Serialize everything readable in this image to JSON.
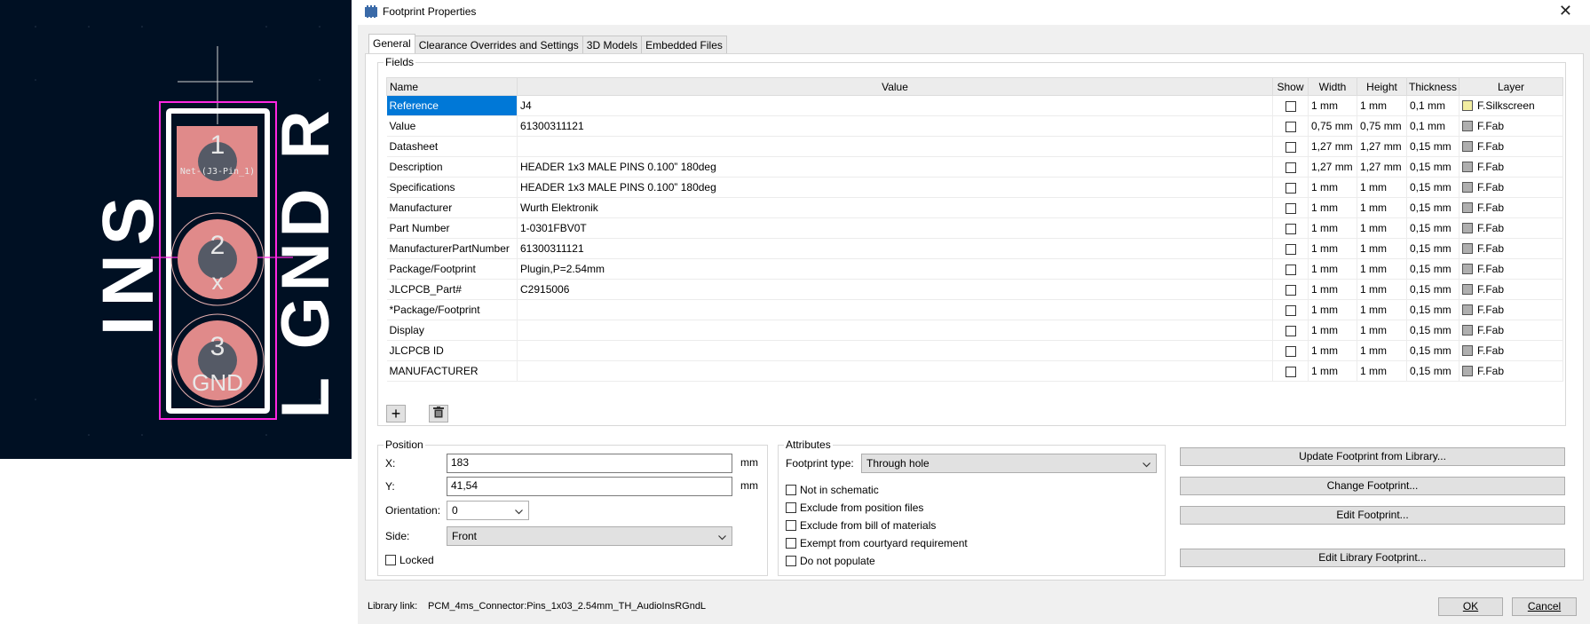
{
  "pcb": {
    "pads": [
      {
        "number": "1",
        "net": "Net-(J3-Pin_1)"
      },
      {
        "number": "2",
        "net": "x"
      },
      {
        "number": "3",
        "net": "GND"
      }
    ],
    "silk_left": "INS",
    "silk_right": "L GND R",
    "colors": {
      "background": "#001023",
      "pad": "#e08a8a",
      "courtyard": "#ff26e2",
      "silkscreen": "#ffffff",
      "drill": "#555a66"
    }
  },
  "dialog": {
    "title": "Footprint Properties",
    "close_glyph": "✕",
    "tabs": [
      "General",
      "Clearance Overrides and Settings",
      "3D Models",
      "Embedded Files"
    ],
    "fields_group": "Fields",
    "columns": [
      "Name",
      "Value",
      "Show",
      "Width",
      "Height",
      "Thickness",
      "Layer"
    ],
    "rows": [
      {
        "name": "Reference",
        "value": "J4",
        "width": "1 mm",
        "height": "1 mm",
        "thickness": "0,1 mm",
        "layer": "F.Silkscreen",
        "layer_color": "#f2eda1"
      },
      {
        "name": "Value",
        "value": "61300311121",
        "width": "0,75 mm",
        "height": "0,75 mm",
        "thickness": "0,1 mm",
        "layer": "F.Fab",
        "layer_color": "#afafaf"
      },
      {
        "name": "Datasheet",
        "value": "",
        "width": "1,27 mm",
        "height": "1,27 mm",
        "thickness": "0,15 mm",
        "layer": "F.Fab",
        "layer_color": "#afafaf"
      },
      {
        "name": "Description",
        "value": "HEADER 1x3 MALE PINS 0.100” 180deg",
        "width": "1,27 mm",
        "height": "1,27 mm",
        "thickness": "0,15 mm",
        "layer": "F.Fab",
        "layer_color": "#afafaf"
      },
      {
        "name": "Specifications",
        "value": "HEADER 1x3 MALE PINS 0.100” 180deg",
        "width": "1 mm",
        "height": "1 mm",
        "thickness": "0,15 mm",
        "layer": "F.Fab",
        "layer_color": "#afafaf"
      },
      {
        "name": "Manufacturer",
        "value": "Wurth Elektronik",
        "width": "1 mm",
        "height": "1 mm",
        "thickness": "0,15 mm",
        "layer": "F.Fab",
        "layer_color": "#afafaf"
      },
      {
        "name": "Part Number",
        "value": "1-0301FBV0T",
        "width": "1 mm",
        "height": "1 mm",
        "thickness": "0,15 mm",
        "layer": "F.Fab",
        "layer_color": "#afafaf"
      },
      {
        "name": "ManufacturerPartNumber",
        "value": "61300311121",
        "width": "1 mm",
        "height": "1 mm",
        "thickness": "0,15 mm",
        "layer": "F.Fab",
        "layer_color": "#afafaf"
      },
      {
        "name": "Package/Footprint",
        "value": "Plugin,P=2.54mm",
        "width": "1 mm",
        "height": "1 mm",
        "thickness": "0,15 mm",
        "layer": "F.Fab",
        "layer_color": "#afafaf"
      },
      {
        "name": "JLCPCB_Part#",
        "value": "C2915006",
        "width": "1 mm",
        "height": "1 mm",
        "thickness": "0,15 mm",
        "layer": "F.Fab",
        "layer_color": "#afafaf"
      },
      {
        "name": "*Package/Footprint",
        "value": "",
        "width": "1 mm",
        "height": "1 mm",
        "thickness": "0,15 mm",
        "layer": "F.Fab",
        "layer_color": "#afafaf"
      },
      {
        "name": "Display",
        "value": "",
        "width": "1 mm",
        "height": "1 mm",
        "thickness": "0,15 mm",
        "layer": "F.Fab",
        "layer_color": "#afafaf"
      },
      {
        "name": "JLCPCB ID",
        "value": "",
        "width": "1 mm",
        "height": "1 mm",
        "thickness": "0,15 mm",
        "layer": "F.Fab",
        "layer_color": "#afafaf"
      },
      {
        "name": "MANUFACTURER",
        "value": "",
        "width": "1 mm",
        "height": "1 mm",
        "thickness": "0,15 mm",
        "layer": "F.Fab",
        "layer_color": "#afafaf"
      }
    ],
    "add_field_glyph": "+",
    "position": {
      "title": "Position",
      "x_label": "X:",
      "x_value": "183",
      "x_unit": "mm",
      "y_label": "Y:",
      "y_value": "41,54",
      "y_unit": "mm",
      "orientation_label": "Orientation:",
      "orientation_value": "0",
      "side_label": "Side:",
      "side_value": "Front",
      "locked_label": "Locked"
    },
    "attributes": {
      "title": "Attributes",
      "footprint_type_label": "Footprint type:",
      "footprint_type_value": "Through hole",
      "checks": [
        "Not in schematic",
        "Exclude from position files",
        "Exclude from bill of materials",
        "Exempt from courtyard requirement",
        "Do not populate"
      ]
    },
    "actions": {
      "update": "Update Footprint from Library...",
      "change": "Change Footprint...",
      "edit": "Edit Footprint...",
      "edit_library": "Edit Library Footprint..."
    },
    "library_link_label": "Library link:",
    "library_link_value": "PCM_4ms_Connector:Pins_1x03_2.54mm_TH_AudioInsRGndL",
    "ok": "OK",
    "cancel": "Cancel"
  }
}
